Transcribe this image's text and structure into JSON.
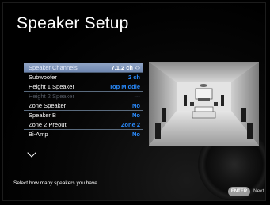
{
  "page": {
    "title": "Speaker Setup"
  },
  "menu": {
    "items": [
      {
        "label": "Speaker Channels",
        "value": "7.1.2 ch",
        "state": "selected"
      },
      {
        "label": "Subwoofer",
        "value": "2 ch",
        "state": "normal"
      },
      {
        "label": "Height 1 Speaker",
        "value": "Top Middle",
        "state": "normal"
      },
      {
        "label": "Height 2 Speaker",
        "value": "---",
        "state": "disabled"
      },
      {
        "label": "Zone Speaker",
        "value": "No",
        "state": "normal"
      },
      {
        "label": "Speaker B",
        "value": "No",
        "state": "normal"
      },
      {
        "label": "Zone 2 Preout",
        "value": "Zone 2",
        "state": "normal"
      },
      {
        "label": "Bi-Amp",
        "value": "No",
        "state": "normal"
      }
    ],
    "selected_arrows": "<>"
  },
  "help_text": "Select how many speakers you have.",
  "footer": {
    "enter_label": "ENTER",
    "next_label": "Next"
  },
  "icons": [
    "left-right-arrows-icon",
    "chevron-down-icon",
    "speaker-room-diagram"
  ]
}
